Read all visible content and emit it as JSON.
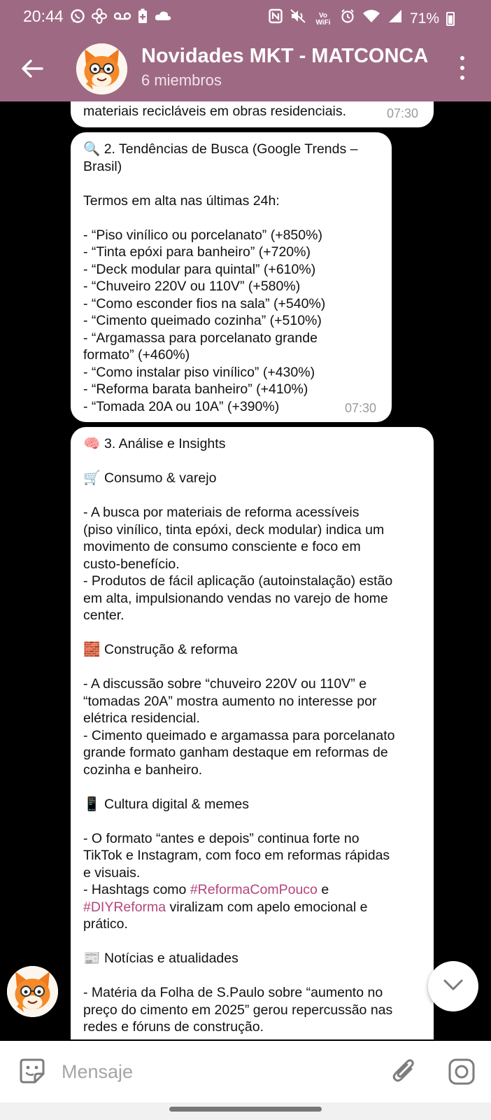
{
  "status_bar": {
    "time": "20:44",
    "left_icons": [
      "whatsapp-icon",
      "fan-icon",
      "voicemail-icon",
      "battery-saver-icon",
      "cloud-icon"
    ],
    "right_icons": [
      "nfc-icon",
      "mute-icon",
      "vowifi-icon",
      "alarm-icon",
      "wifi-icon",
      "signal-icon"
    ],
    "vowifi": "Vo WiFi",
    "battery": "71%"
  },
  "header": {
    "title": "Novidades MKT - MATCONCA",
    "subtitle": "6 miembros",
    "color": "#9e6a83"
  },
  "messages": [
    {
      "lines": [
        "materiais recicláveis em obras residenciais."
      ],
      "time": "07:30"
    },
    {
      "lines": [
        "🔍 2. Tendências de Busca (Google Trends –",
        "Brasil)",
        "",
        "Termos em alta nas últimas 24h:",
        "",
        "- “Piso vinílico ou porcelanato” (+850%)",
        "- “Tinta epóxi para banheiro” (+720%)",
        "- “Deck modular para quintal” (+610%)",
        "- “Chuveiro 220V ou 110V” (+580%)",
        "- “Como esconder fios na sala” (+540%)",
        "- “Cimento queimado cozinha” (+510%)",
        "- “Argamassa para porcelanato grande",
        "formato” (+460%)",
        "- “Como instalar piso vinílico” (+430%)",
        "- “Reforma barata banheiro” (+410%)",
        "- “Tomada 20A ou 10A” (+390%)"
      ],
      "time": "07:30"
    },
    {
      "section_title": "3. Análise e Insights",
      "consumo_title": "Consumo & varejo",
      "consumo_lines": [
        "- A busca por materiais de reforma acessíveis",
        "(piso vinílico, tinta epóxi, deck modular) indica um",
        "movimento de consumo consciente e foco em",
        "custo-benefício.",
        "- Produtos de fácil aplicação (autoinstalação) estão",
        "em alta, impulsionando vendas no varejo de home",
        "center."
      ],
      "construcao_title": "Construção & reforma",
      "construcao_lines": [
        "- A discussão sobre “chuveiro 220V ou 110V” e",
        "“tomadas 20A” mostra aumento no interesse por",
        "elétrica residencial.",
        "- Cimento queimado e argamassa para porcelanato",
        "grande formato ganham destaque em reformas de",
        "cozinha e banheiro."
      ],
      "cultura_title": "Cultura digital & memes",
      "cultura_lines": [
        "- O formato “antes e depois” continua forte no",
        "TikTok e Instagram, com foco em reformas rápidas",
        "e visuais."
      ],
      "hashtag_line1_pre": "- Hashtags como ",
      "hashtag1": "#ReformaComPouco",
      "hashtag_line1_post": " e",
      "hashtag2": "#DIYReforma",
      "hashtag_line2_post": " viralizam com apelo emocional e",
      "hashtag_line3": "prático.",
      "noticias_title": "Notícias e atualidades",
      "noticias_lines": [
        "- Matéria da Folha de S.Paulo sobre “aumento no",
        "preço do cimento em 2025” gerou repercussão nas",
        "redes e fóruns de construção."
      ],
      "hashtag_color": "#b4457a"
    }
  ],
  "input": {
    "placeholder": "Mensaje"
  }
}
